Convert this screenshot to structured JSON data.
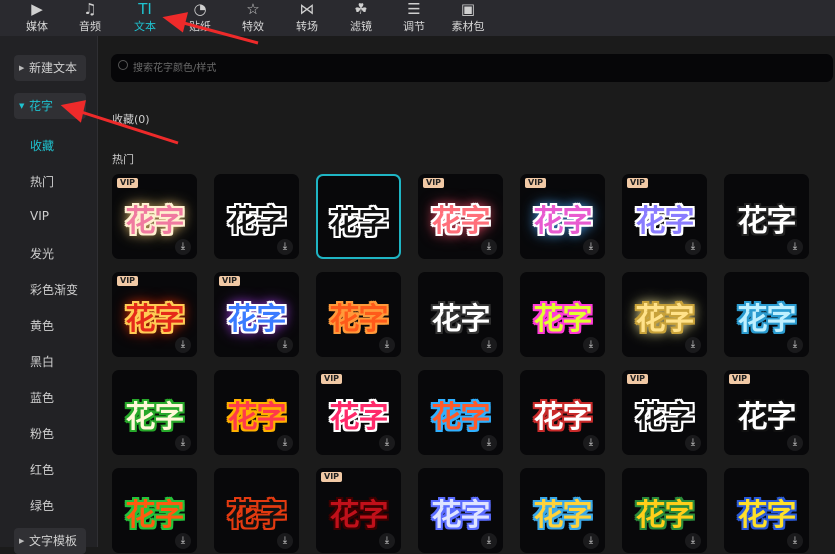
{
  "tabs": [
    {
      "label": "媒体",
      "icon": "media-icon",
      "glyph": "▶"
    },
    {
      "label": "音频",
      "icon": "audio-icon",
      "glyph": "♫"
    },
    {
      "label": "文本",
      "icon": "text-icon",
      "glyph": "TI",
      "active": true
    },
    {
      "label": "贴纸",
      "icon": "sticker-icon",
      "glyph": "◔"
    },
    {
      "label": "特效",
      "icon": "effects-icon",
      "glyph": "☆"
    },
    {
      "label": "转场",
      "icon": "transition-icon",
      "glyph": "⋈"
    },
    {
      "label": "滤镜",
      "icon": "filter-icon",
      "glyph": "☘"
    },
    {
      "label": "调节",
      "icon": "adjust-icon",
      "glyph": "☰"
    },
    {
      "label": "素材包",
      "icon": "package-icon",
      "glyph": "▣"
    }
  ],
  "sidebar": {
    "new_text": "新建文本",
    "huazi": "花字",
    "items": [
      "收藏",
      "热门",
      "VIP",
      "发光",
      "彩色渐变",
      "黄色",
      "黑白",
      "蓝色",
      "粉色",
      "红色",
      "绿色"
    ],
    "templates": "文字模板"
  },
  "search": {
    "placeholder": "搜索花字颜色/样式"
  },
  "sections": {
    "favorites": "收藏(0)",
    "hot": "热门"
  },
  "accent": "#1fc2cf",
  "tile_text": "花字",
  "vip_label": "VIP",
  "tiles": [
    {
      "fill": "#f07aa0",
      "stroke": "#fff0d0",
      "glow": "#ffd27a",
      "vip": true
    },
    {
      "fill": "#111",
      "stroke": "#fff",
      "vip": false
    },
    {
      "fill": "#111",
      "stroke": "#fff",
      "vip": false,
      "selected": true
    },
    {
      "fill": "#ff6f7a",
      "stroke": "#fff",
      "glow": "#ff4d6a",
      "vip": true
    },
    {
      "fill": "#e85bd0",
      "stroke": "#fff",
      "glow": "#4aa8ff",
      "vip": true
    },
    {
      "fill": "#8a7cff",
      "stroke": "#fff",
      "vip": true
    },
    {
      "fill": "#fff",
      "stroke": "#222",
      "vip": false
    },
    {
      "fill": "#e52a1a",
      "stroke": "#ffcc55",
      "glow": "#ff3300",
      "vip": true
    },
    {
      "fill": "#3a7bff",
      "stroke": "#fff",
      "glow": "#b040ff",
      "vip": true
    },
    {
      "fill": "#ff5a1a",
      "stroke": "#ff9a3a",
      "vip": false
    },
    {
      "fill": "#fff",
      "stroke": "#333",
      "vip": false
    },
    {
      "fill": "#e0ff30",
      "stroke": "#ff3ad8",
      "vip": false
    },
    {
      "fill": "#ffe28a",
      "stroke": "#c8a23a",
      "glow": "#fff1a0",
      "vip": false
    },
    {
      "fill": "#bff0ff",
      "stroke": "#2a9bd0",
      "vip": false
    },
    {
      "fill": "#fff8d8",
      "stroke": "#27a82a",
      "vip": false
    },
    {
      "fill": "#ff3a4a",
      "stroke": "#ffb000",
      "vip": false
    },
    {
      "fill": "#ff2a6a",
      "stroke": "#fff",
      "vip": true
    },
    {
      "fill": "#ff5a2a",
      "stroke": "#30b0ff",
      "vip": false
    },
    {
      "fill": "#fff",
      "stroke": "#c82a2a",
      "vip": false
    },
    {
      "fill": "#111",
      "stroke": "#fff",
      "vip": true
    },
    {
      "fill": "#fff",
      "stroke": "#111",
      "vip": true
    },
    {
      "fill": "#ff5a10",
      "stroke": "#24c23a",
      "vip": false
    },
    {
      "fill": "#111",
      "stroke": "#e33a10",
      "vip": false
    },
    {
      "fill": "#c0101a",
      "stroke": "#3a0000",
      "vip": true
    },
    {
      "fill": "#dfe4ff",
      "stroke": "#5a6cff",
      "vip": false
    },
    {
      "fill": "#ffd23a",
      "stroke": "#3aa8e8",
      "vip": false
    },
    {
      "fill": "#ffcf1a",
      "stroke": "#2a8a3a",
      "vip": false
    },
    {
      "fill": "#ffe02a",
      "stroke": "#2a5ad8",
      "vip": false
    }
  ]
}
